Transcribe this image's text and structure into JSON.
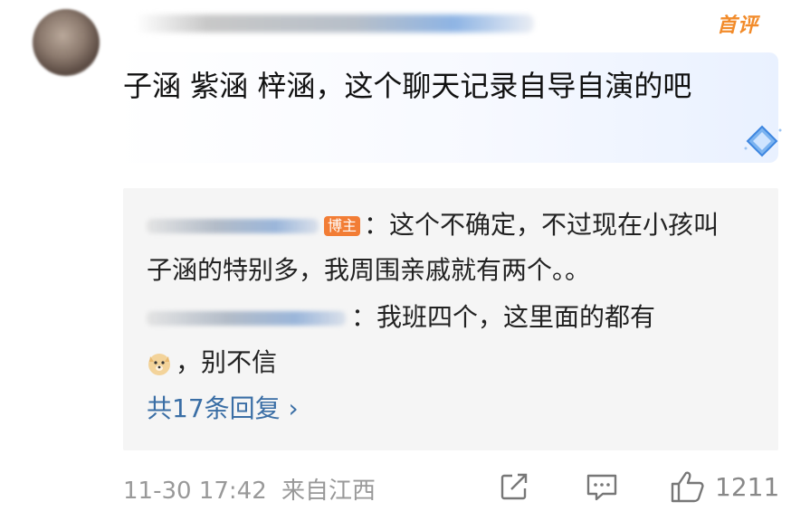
{
  "comment": {
    "badge": "首评",
    "text": "子涵 紫涵 梓涵，这个聊天记录自导自演的吧"
  },
  "replies": [
    {
      "tag": "博主",
      "text": "：这个不确定，不过现在小孩叫子涵的特别多，我周围亲戚就有两个。。"
    },
    {
      "text_a": "：我班四个，这里面的都有",
      "text_b": "，别不信"
    }
  ],
  "more_replies": "共17条回复 ›",
  "meta": {
    "time": "11-30 17:42",
    "location": "来自江西"
  },
  "actions": {
    "like_count": "1211"
  },
  "colors": {
    "accent_orange": "#f28b2a",
    "link_blue": "#3a6ea5",
    "reply_bg": "#f5f5f5"
  },
  "icons": [
    "share-icon",
    "comment-icon",
    "thumbs-up-icon",
    "doge-emoji-icon",
    "diamond-badge-icon"
  ]
}
